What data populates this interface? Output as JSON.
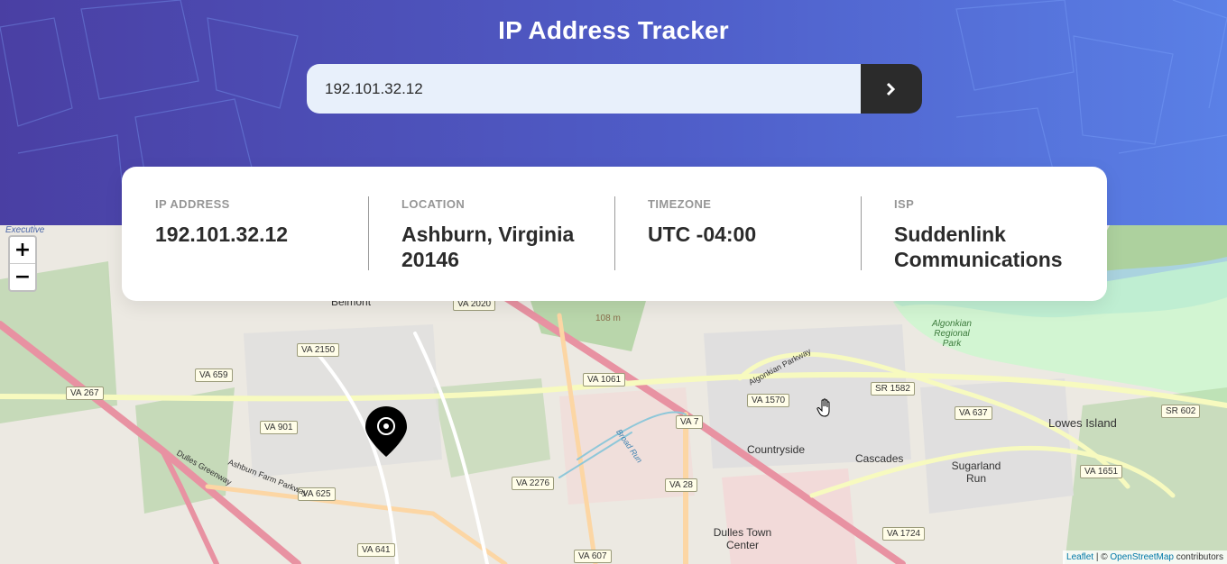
{
  "header": {
    "title": "IP Address Tracker"
  },
  "search": {
    "value": "192.101.32.12",
    "submit_icon": "chevron-right-icon"
  },
  "info": [
    {
      "label": "IP ADDRESS",
      "value": "192.101.32.12"
    },
    {
      "label": "LOCATION",
      "value": "Ashburn, Virginia 20146"
    },
    {
      "label": "TIMEZONE",
      "value": "UTC -04:00"
    },
    {
      "label": "ISP",
      "value": "Suddenlink Communications"
    }
  ],
  "map": {
    "zoom_in": "+",
    "zoom_out": "−",
    "attribution": {
      "leaflet": "Leaflet",
      "sep": " | © ",
      "osm": "OpenStreetMap",
      "tail": " contributors"
    },
    "places": [
      {
        "text": "Belmont"
      },
      {
        "text": "Countryside"
      },
      {
        "text": "Cascades"
      },
      {
        "text": "Lowes Island"
      },
      {
        "text": "Sugarland Run"
      },
      {
        "text": "Dulles Town Center"
      },
      {
        "text": "Algonkian Regional Park"
      },
      {
        "text": "Executive"
      },
      {
        "text": "108 m"
      }
    ],
    "shields": [
      {
        "text": "VA 2020"
      },
      {
        "text": "VA 2150"
      },
      {
        "text": "VA 659"
      },
      {
        "text": "VA 267"
      },
      {
        "text": "VA 901"
      },
      {
        "text": "VA 625"
      },
      {
        "text": "VA 641"
      },
      {
        "text": "VA 1061"
      },
      {
        "text": "VA 2276"
      },
      {
        "text": "VA 7"
      },
      {
        "text": "VA 28"
      },
      {
        "text": "VA 607"
      },
      {
        "text": "VA 1570"
      },
      {
        "text": "SR 1582"
      },
      {
        "text": "VA 637"
      },
      {
        "text": "SR 602"
      },
      {
        "text": "VA 1651"
      },
      {
        "text": "VA 1724"
      }
    ],
    "road_labels": [
      {
        "text": "Algonkian Parkway"
      },
      {
        "text": "Ashburn Farm Parkway"
      },
      {
        "text": "Dulles Greenway"
      },
      {
        "text": "Broad Run"
      }
    ]
  },
  "colors": {
    "header_start": "#4a3fa3",
    "header_end": "#5a80e6",
    "input_bg": "#e8f0fb",
    "button_bg": "#2b2b2b",
    "label_gray": "#969696",
    "value_dark": "#2b2b2b"
  }
}
